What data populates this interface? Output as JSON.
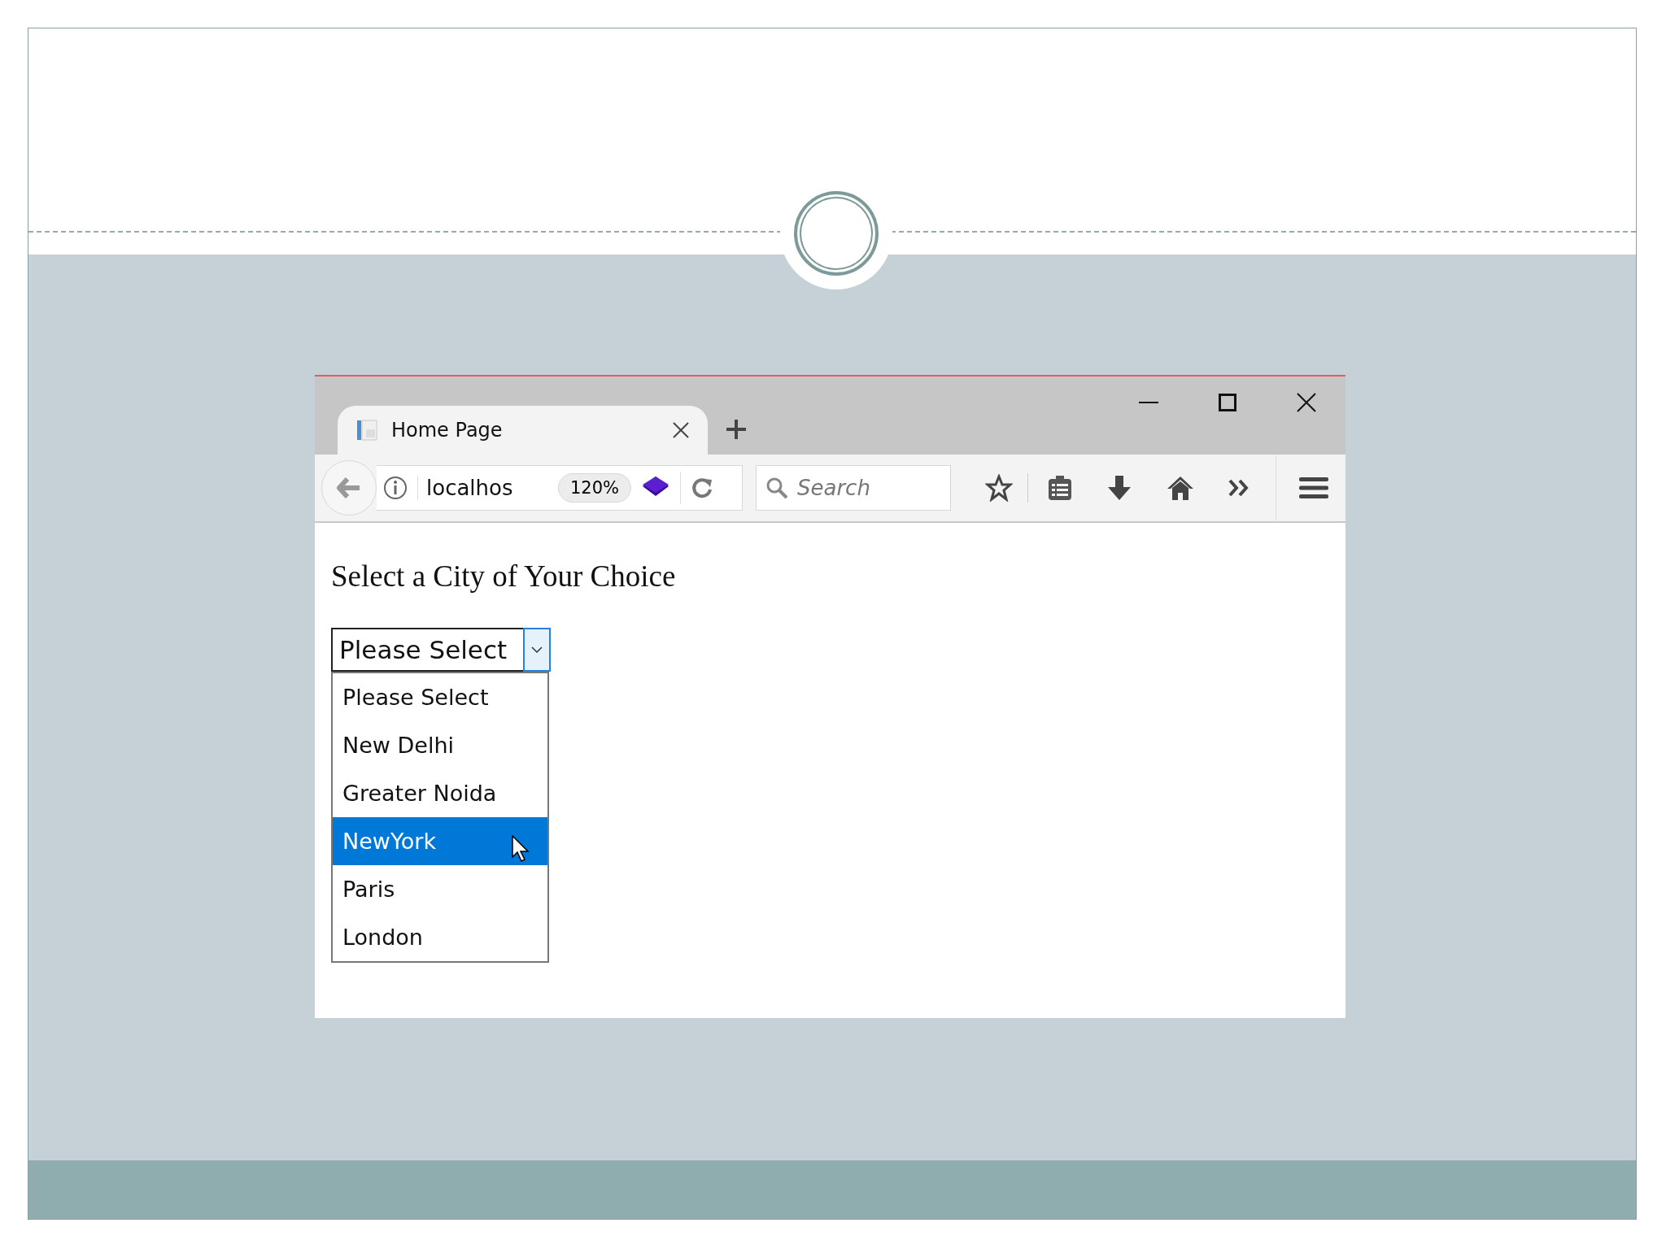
{
  "browser": {
    "tab": {
      "title": "Home Page"
    },
    "address": {
      "url": "localhos",
      "zoom": "120%"
    },
    "search": {
      "placeholder": "Search"
    }
  },
  "page": {
    "heading": "Select a City of Your Choice",
    "select": {
      "value": "Please Select",
      "expanded": true,
      "options": [
        {
          "label": "Please Select",
          "highlighted": false
        },
        {
          "label": "New Delhi",
          "highlighted": false
        },
        {
          "label": "Greater Noida",
          "highlighted": false
        },
        {
          "label": "NewYork",
          "highlighted": true
        },
        {
          "label": "Paris",
          "highlighted": false
        },
        {
          "label": "London",
          "highlighted": false
        }
      ]
    }
  }
}
